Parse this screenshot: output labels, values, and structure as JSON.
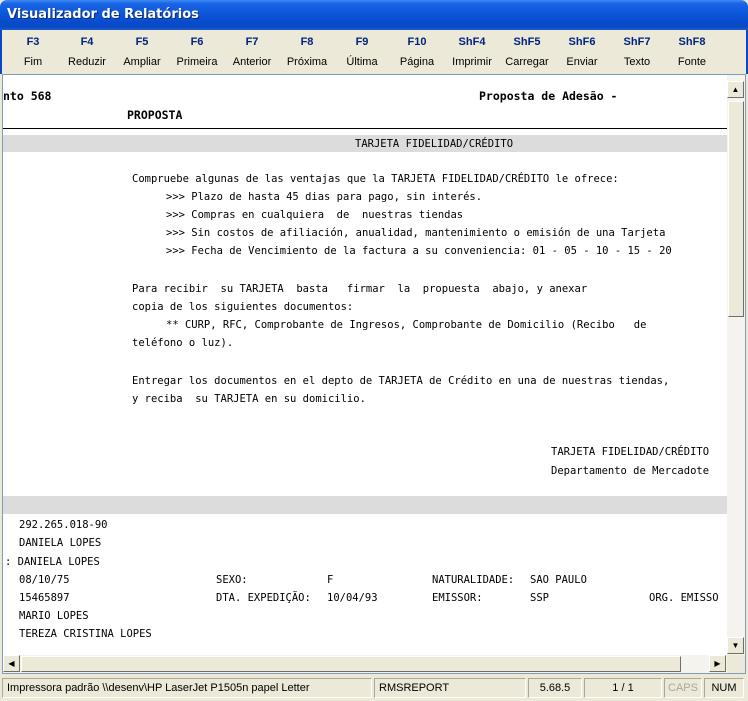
{
  "window": {
    "title": "Visualizador de Relatórios"
  },
  "toolbar": [
    {
      "key": "F3",
      "label": "Fim"
    },
    {
      "key": "F4",
      "label": "Reduzir"
    },
    {
      "key": "F5",
      "label": "Ampliar"
    },
    {
      "key": "F6",
      "label": "Primeira"
    },
    {
      "key": "F7",
      "label": "Anterior"
    },
    {
      "key": "F8",
      "label": "Próxima"
    },
    {
      "key": "F9",
      "label": "Última"
    },
    {
      "key": "F10",
      "label": "Página"
    },
    {
      "key": "ShF4",
      "label": "Imprimir"
    },
    {
      "key": "ShF5",
      "label": "Carregar"
    },
    {
      "key": "ShF6",
      "label": "Enviar"
    },
    {
      "key": "ShF7",
      "label": "Texto"
    },
    {
      "key": "ShF8",
      "label": "Fonte"
    }
  ],
  "report": {
    "header_left": "nto 568",
    "header_right": "Proposta de Adesão -",
    "subheader": "PROPOSTA",
    "section_title": "TARJETA FIDELIDAD/CRÉDITO",
    "intro": "Compruebe algunas de las ventajas que la TARJETA FIDELIDAD/CRÉDITO le ofrece:",
    "benefits": [
      ">>> Plazo de hasta 45 dias para pago, sin interés.",
      ">>> Compras en cualquiera  de  nuestras tiendas",
      ">>> Sin costos de afiliación, anualidad, mantenimiento o emisión de una Tarjeta",
      ">>> Fecha de Vencimiento de la factura a su conveniencia: 01 - 05 - 10 - 15 - 20"
    ],
    "para1_line1": "Para recibir  su TARJETA  basta   firmar  la  propuesta  abajo, y anexar",
    "para1_line2": "copia de los siguientes documentos:",
    "docs_line1": "** CURP, RFC, Comprobante de Ingresos, Comprobante de Domicilio (Recibo   de",
    "docs_line2": "teléfono o luz).",
    "para2_line1": "Entregar los documentos en el depto de TARJETA de Crédito en una de nuestras tiendas,",
    "para2_line2": "y reciba  su TARJETA en su domicilio.",
    "sign_line1": "TARJETA FIDELIDAD/CRÉDITO",
    "sign_line2": "Departamento de Mercadote",
    "cpf": "292.265.018-90",
    "name": "DANIELA LOPES",
    "name2": ": DANIELA LOPES",
    "birth_date": "08/10/75",
    "sexo_label": "SEXO:",
    "sexo_value": "F",
    "naturalidade_label": "NATURALIDADE:",
    "naturalidade_value": "SAO PAULO",
    "rg": "15465897",
    "dta_label": "DTA. EXPEDIÇÃO:",
    "dta_value": "10/04/93",
    "emissor_label": "EMISSOR:",
    "emissor_value": "SSP",
    "org_label": "ORG. EMISSO",
    "father": "MARIO LOPES",
    "mother": "TEREZA CRISTINA LOPES"
  },
  "status": {
    "printer": "Impressora padrão \\\\desenv\\HP LaserJet P1505n papel Letter",
    "report": "RMSREPORT",
    "version": "5.68.5",
    "pages": "1 / 1",
    "caps": "CAPS",
    "num": "NUM"
  }
}
